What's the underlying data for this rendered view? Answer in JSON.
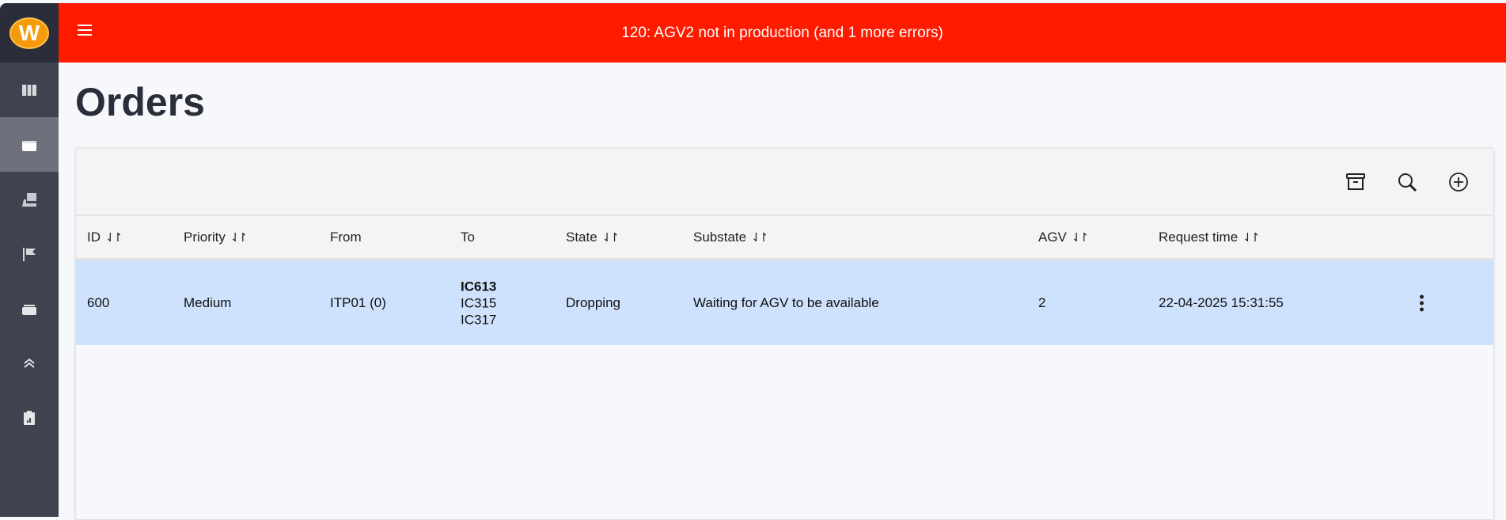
{
  "sidebar": {
    "logo": "W",
    "items": [
      {
        "icon": "map-icon"
      },
      {
        "icon": "box-icon",
        "active": true
      },
      {
        "icon": "forklift-icon"
      },
      {
        "icon": "flag-icon"
      },
      {
        "icon": "stack-icon"
      },
      {
        "icon": "chevrons-up-icon"
      },
      {
        "icon": "report-icon"
      }
    ]
  },
  "topbar": {
    "message": "120: AGV2 not in production (and 1 more errors)"
  },
  "page": {
    "title": "Orders"
  },
  "table": {
    "columns": [
      {
        "label": "ID",
        "sortable": true
      },
      {
        "label": "Priority",
        "sortable": true
      },
      {
        "label": "From",
        "sortable": false
      },
      {
        "label": "To",
        "sortable": false
      },
      {
        "label": "State",
        "sortable": true
      },
      {
        "label": "Substate",
        "sortable": true
      },
      {
        "label": "AGV",
        "sortable": true
      },
      {
        "label": "Request time",
        "sortable": true
      }
    ],
    "sort_glyph": "⇃↾",
    "rows": [
      {
        "id": "600",
        "priority": "Medium",
        "from": "ITP01 (0)",
        "to": [
          "IC613",
          "IC315",
          "IC317"
        ],
        "state": "Dropping",
        "substate": "Waiting for AGV to be available",
        "agv": "2",
        "request_time": "22-04-2025 15:31:55"
      }
    ]
  },
  "colors": {
    "error_bar": "#ff1a00",
    "selected_row": "#cfe2fd",
    "sidebar": "#3f4350"
  }
}
